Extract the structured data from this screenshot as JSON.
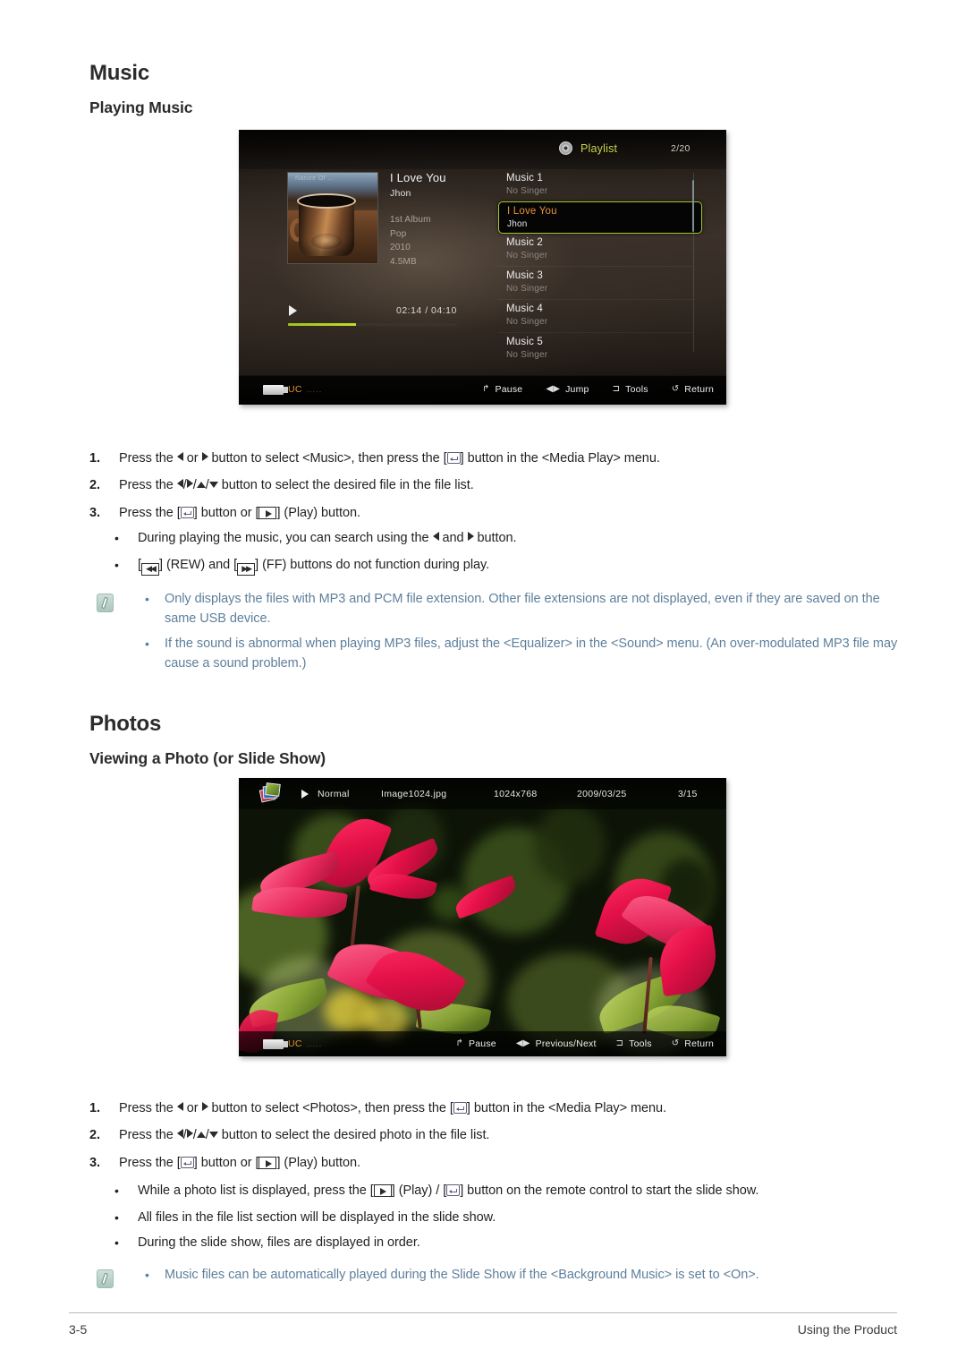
{
  "document": {
    "section_music_title": "Music",
    "subsection_playing_music": "Playing Music",
    "section_photos_title": "Photos",
    "subsection_viewing_photo": "Viewing a Photo (or Slide Show)"
  },
  "music_player": {
    "playlist_label": "Playlist",
    "playlist_count": "2/20",
    "album_art_label": "Nature Of ...",
    "now_playing": {
      "title": "I Love You",
      "artist": "Jhon",
      "album": "1st Album",
      "genre": "Pop",
      "year": "2010",
      "size": "4.5MB"
    },
    "progress": {
      "elapsed_total": "02:14 / 04:10",
      "percent": 40
    },
    "playlist_items": [
      {
        "title": "Music 1",
        "subtitle": "No Singer",
        "selected": false
      },
      {
        "title": "I Love You",
        "subtitle": "Jhon",
        "selected": true
      },
      {
        "title": "Music 2",
        "subtitle": "No Singer",
        "selected": false
      },
      {
        "title": "Music 3",
        "subtitle": "No Singer",
        "selected": false
      },
      {
        "title": "Music 4",
        "subtitle": "No Singer",
        "selected": false
      },
      {
        "title": "Music 5",
        "subtitle": "No Singer",
        "selected": false
      }
    ],
    "status_bar": {
      "device_label": "UC",
      "device_dots": ".....",
      "hints": [
        {
          "glyph": "↱",
          "label": "Pause"
        },
        {
          "glyph": "◀▶",
          "label": "Jump"
        },
        {
          "glyph": "⊐",
          "label": "Tools"
        },
        {
          "glyph": "↺",
          "label": "Return"
        }
      ]
    }
  },
  "photo_viewer": {
    "top_bar": {
      "mode": "Normal",
      "filename": "Image1024.jpg",
      "resolution": "1024x768",
      "date": "2009/03/25",
      "index": "3/15"
    },
    "status_bar": {
      "device_label": "UC",
      "device_dots": ".....",
      "hints": [
        {
          "glyph": "↱",
          "label": "Pause"
        },
        {
          "glyph": "◀▶",
          "label": "Previous/Next"
        },
        {
          "glyph": "⊐",
          "label": "Tools"
        },
        {
          "glyph": "↺",
          "label": "Return"
        }
      ]
    }
  },
  "music_steps": {
    "step1_num": "1.",
    "step1_a": "Press the",
    "step1_b": "or",
    "step1_c": "button to select <Music>, then press the [",
    "step1_d": "] button in the <Media Play> menu.",
    "step2_num": "2.",
    "step2_a": "Press the",
    "step2_b": "button to select the desired file in the file list.",
    "step3_num": "3.",
    "step3_a": "Press the [",
    "step3_b": "] button or [",
    "step3_c": "] (Play) button.",
    "bullet1_a": "During playing the music, you can search using the",
    "bullet1_b": "and",
    "bullet1_c": "button.",
    "bullet2_a": "[",
    "bullet2_b": "] (REW) and [",
    "bullet2_c": "] (FF) buttons do not function during play."
  },
  "music_notes": [
    "Only displays the files with MP3 and PCM file extension. Other file extensions are not displayed, even if they are saved on the same USB device.",
    "If the sound is abnormal when playing MP3 files, adjust the <Equalizer> in the <Sound> menu. (An over-modulated MP3 file may cause a sound problem.)"
  ],
  "photo_steps": {
    "step1_num": "1.",
    "step1_a": "Press the",
    "step1_b": "or",
    "step1_c": "button to select <Photos>, then press the [",
    "step1_d": "] button in the <Media Play> menu.",
    "step2_num": "2.",
    "step2_a": "Press the",
    "step2_b": "button to select the desired photo in the file list.",
    "step3_num": "3.",
    "step3_a": "Press the [",
    "step3_b": "] button or [",
    "step3_c": "] (Play) button.",
    "bullet1_a": "While a photo list is displayed, press the [",
    "bullet1_b": "] (Play) / [",
    "bullet1_c": "] button on the remote control to start the slide show.",
    "bullet2": "All files in the file list section will be displayed in the slide show.",
    "bullet3": "During the slide show, files are displayed in order."
  },
  "photo_notes": [
    "Music files can be automatically played during the Slide Show if the <Background Music> is set to <On>."
  ],
  "footer": {
    "page_number": "3-5",
    "chapter": "Using the Product"
  },
  "colors": {
    "accent_green": "#a8c62c",
    "playlist_label": "#c9d44a",
    "selected_title": "#e8913a",
    "usb_orange": "#e0922f",
    "note_text": "#5d7f9c",
    "heading": "#2b2b2b"
  },
  "bullet_char": "•"
}
